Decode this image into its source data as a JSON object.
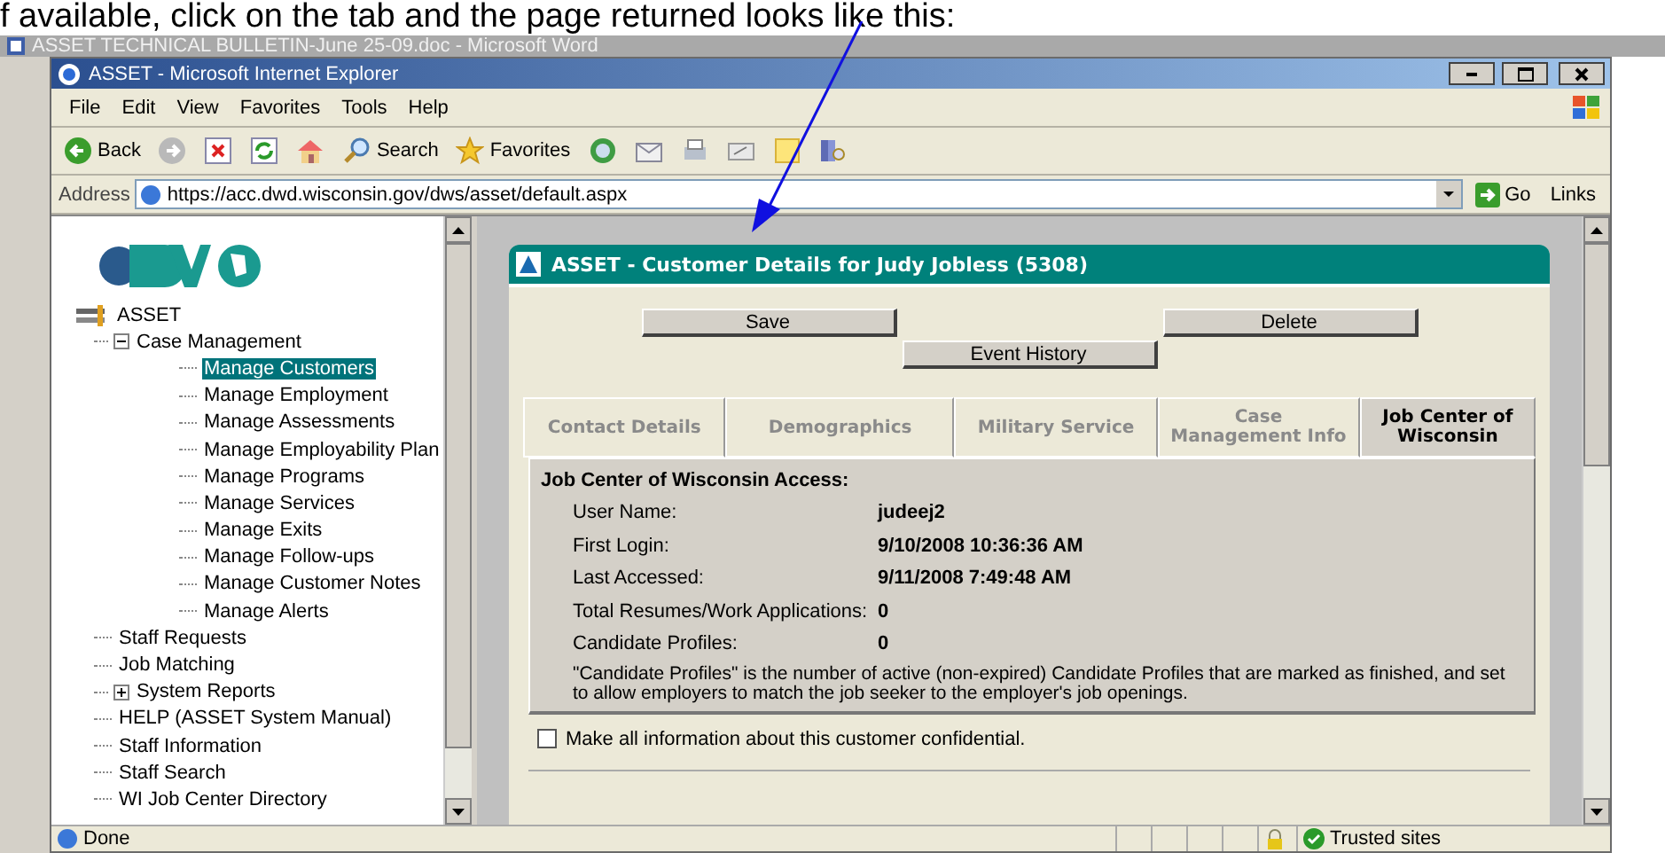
{
  "document_text": "f available, click on the tab and the page returned looks like this:",
  "word_window": {
    "title": "ASSET TECHNICAL BULLETIN-June 25-09.doc - Microsoft Word"
  },
  "browser": {
    "title": "ASSET - Microsoft Internet Explorer",
    "menu": [
      "File",
      "Edit",
      "View",
      "Favorites",
      "Tools",
      "Help"
    ],
    "toolbar": [
      {
        "kind": "back",
        "label": "Back"
      },
      {
        "kind": "forward"
      },
      {
        "kind": "stop"
      },
      {
        "kind": "refresh"
      },
      {
        "kind": "home"
      },
      {
        "kind": "search",
        "label": "Search"
      },
      {
        "kind": "favorites",
        "label": "Favorites"
      },
      {
        "kind": "media"
      },
      {
        "kind": "mail"
      },
      {
        "kind": "print"
      },
      {
        "kind": "edit"
      },
      {
        "kind": "note"
      },
      {
        "kind": "research"
      }
    ],
    "address": {
      "label": "Address",
      "value": "https://acc.dwd.wisconsin.gov/dws/asset/default.aspx",
      "go": "Go",
      "links": "Links"
    },
    "status": {
      "text": "Done",
      "zone": "Trusted sites"
    }
  },
  "sidebar": {
    "tree": [
      {
        "label": "ASSET",
        "children": [
          {
            "label": "Case Management",
            "expanded": true,
            "children": [
              {
                "label": "Manage Customers",
                "selected": true
              },
              {
                "label": "Manage Employment",
                "selected": false
              },
              {
                "label": "Manage Assessments",
                "selected": false
              },
              {
                "label": "Manage Employability Plan",
                "selected": false
              },
              {
                "label": "Manage Programs",
                "selected": false
              },
              {
                "label": "Manage Services",
                "selected": false
              },
              {
                "label": "Manage Exits",
                "selected": false
              },
              {
                "label": "Manage Follow-ups",
                "selected": false
              },
              {
                "label": "Manage Customer Notes",
                "selected": false
              },
              {
                "label": "Manage Alerts",
                "selected": false
              }
            ]
          },
          {
            "label": "Staff Requests",
            "selected": false
          },
          {
            "label": "Job Matching",
            "selected": false
          },
          {
            "label": "System Reports",
            "expanded": false
          },
          {
            "label": "HELP (ASSET System Manual)",
            "selected": false
          },
          {
            "label": "Staff Information",
            "selected": false
          },
          {
            "label": "Staff Search",
            "selected": false
          },
          {
            "label": "WI Job Center Directory",
            "selected": false
          }
        ]
      }
    ]
  },
  "panel": {
    "title": "ASSET - Customer Details for Judy Jobless (5308)",
    "buttons": [
      "Save",
      "Delete",
      "Event History"
    ],
    "tabs": [
      {
        "label": "Contact Details",
        "selected": false
      },
      {
        "label": "Demographics",
        "selected": false
      },
      {
        "label": "Military Service",
        "selected": false
      },
      {
        "label": "Case Management Info",
        "selected": false
      },
      {
        "label": "Job Center of Wisconsin",
        "selected": true
      }
    ],
    "section_title": "Job Center of Wisconsin Access:",
    "fields": [
      {
        "label": "User Name:",
        "value": "judeej2"
      },
      {
        "label": "First Login:",
        "value": "9/10/2008 10:36:36 AM"
      },
      {
        "label": "Last Accessed:",
        "value": "9/11/2008 7:49:48 AM"
      },
      {
        "label": "Total Resumes/Work Applications:",
        "value": "0"
      },
      {
        "label": "Candidate Profiles:",
        "value": "0"
      }
    ],
    "note": "\"Candidate Profiles\" is the number of active (non-expired) Candidate Profiles that are marked as finished, and set to allow employers to match the job seeker to the employer's job openings.",
    "confidential": {
      "label": "Make all information about this customer confidential.",
      "checked": false
    }
  }
}
